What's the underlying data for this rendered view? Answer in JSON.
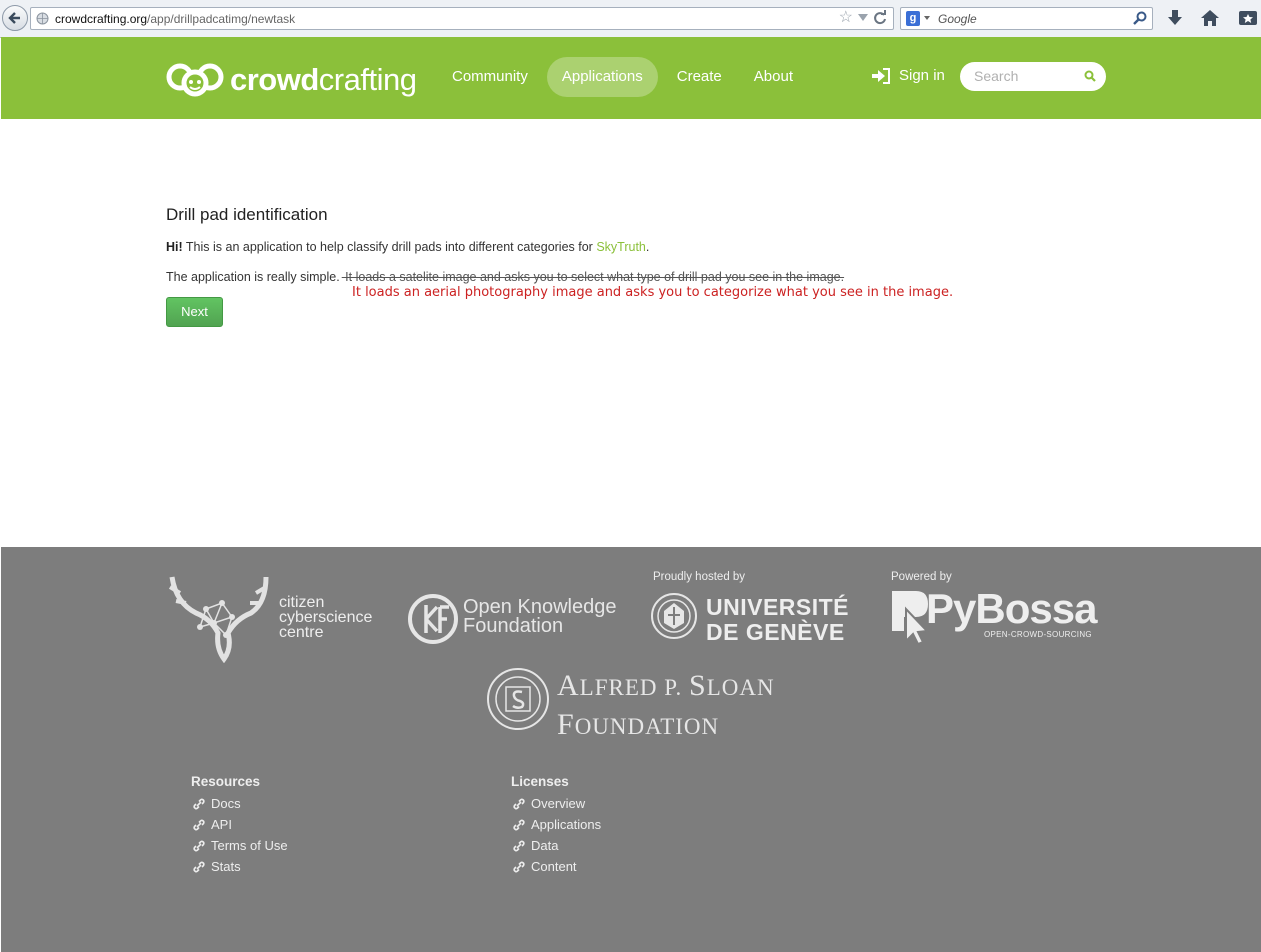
{
  "browser": {
    "url_host": "crowdcrafting.org",
    "url_path": "/app/drillpadcatimg/newtask",
    "search_placeholder": "Google"
  },
  "nav": {
    "brand_bold": "crowd",
    "brand_rest": "crafting",
    "links": [
      "Community",
      "Applications",
      "Create",
      "About"
    ],
    "active": "Applications",
    "signin": "Sign in",
    "search_placeholder": "Search"
  },
  "main": {
    "title": "Drill pad identification",
    "hi": "Hi!",
    "intro": " This is an application to help classify drill pads into different categories for ",
    "skytruth": "SkyTruth",
    "intro_end": ".",
    "simple": "The application is really simple.",
    "struck": " It loads a satelite image and asks you to select what type of drill pad you see in the image.",
    "annotation": "It loads an aerial photography image and asks you to categorize what you see in the image.",
    "next": "Next"
  },
  "footer": {
    "cyber": [
      "citizen",
      "cyberscience",
      "centre"
    ],
    "okf": [
      "Open Knowledge",
      "Foundation"
    ],
    "hosted_label": "Proudly hosted by",
    "unige": [
      "UNIVERSITÉ",
      "DE GENÈVE"
    ],
    "powered_label": "Powered by",
    "pybossa": "PyBossa",
    "pybossa_sub": "OPEN-CROWD-SOURCING",
    "sloan_line1_a": "A",
    "sloan_line1_b": "LFRED P. ",
    "sloan_line1_c": "S",
    "sloan_line1_d": "LOAN",
    "sloan_line2_a": "F",
    "sloan_line2_b": "OUNDATION",
    "resources": {
      "title": "Resources",
      "items": [
        "Docs",
        "API",
        "Terms of Use",
        "Stats"
      ]
    },
    "licenses": {
      "title": "Licenses",
      "items": [
        "Overview",
        "Applications",
        "Data",
        "Content"
      ]
    }
  },
  "colors": {
    "brand_green": "#8bc03a",
    "button_green": "#5bb75b",
    "footer_gray": "#7d7d7d",
    "annotation_red": "#cc2222"
  }
}
